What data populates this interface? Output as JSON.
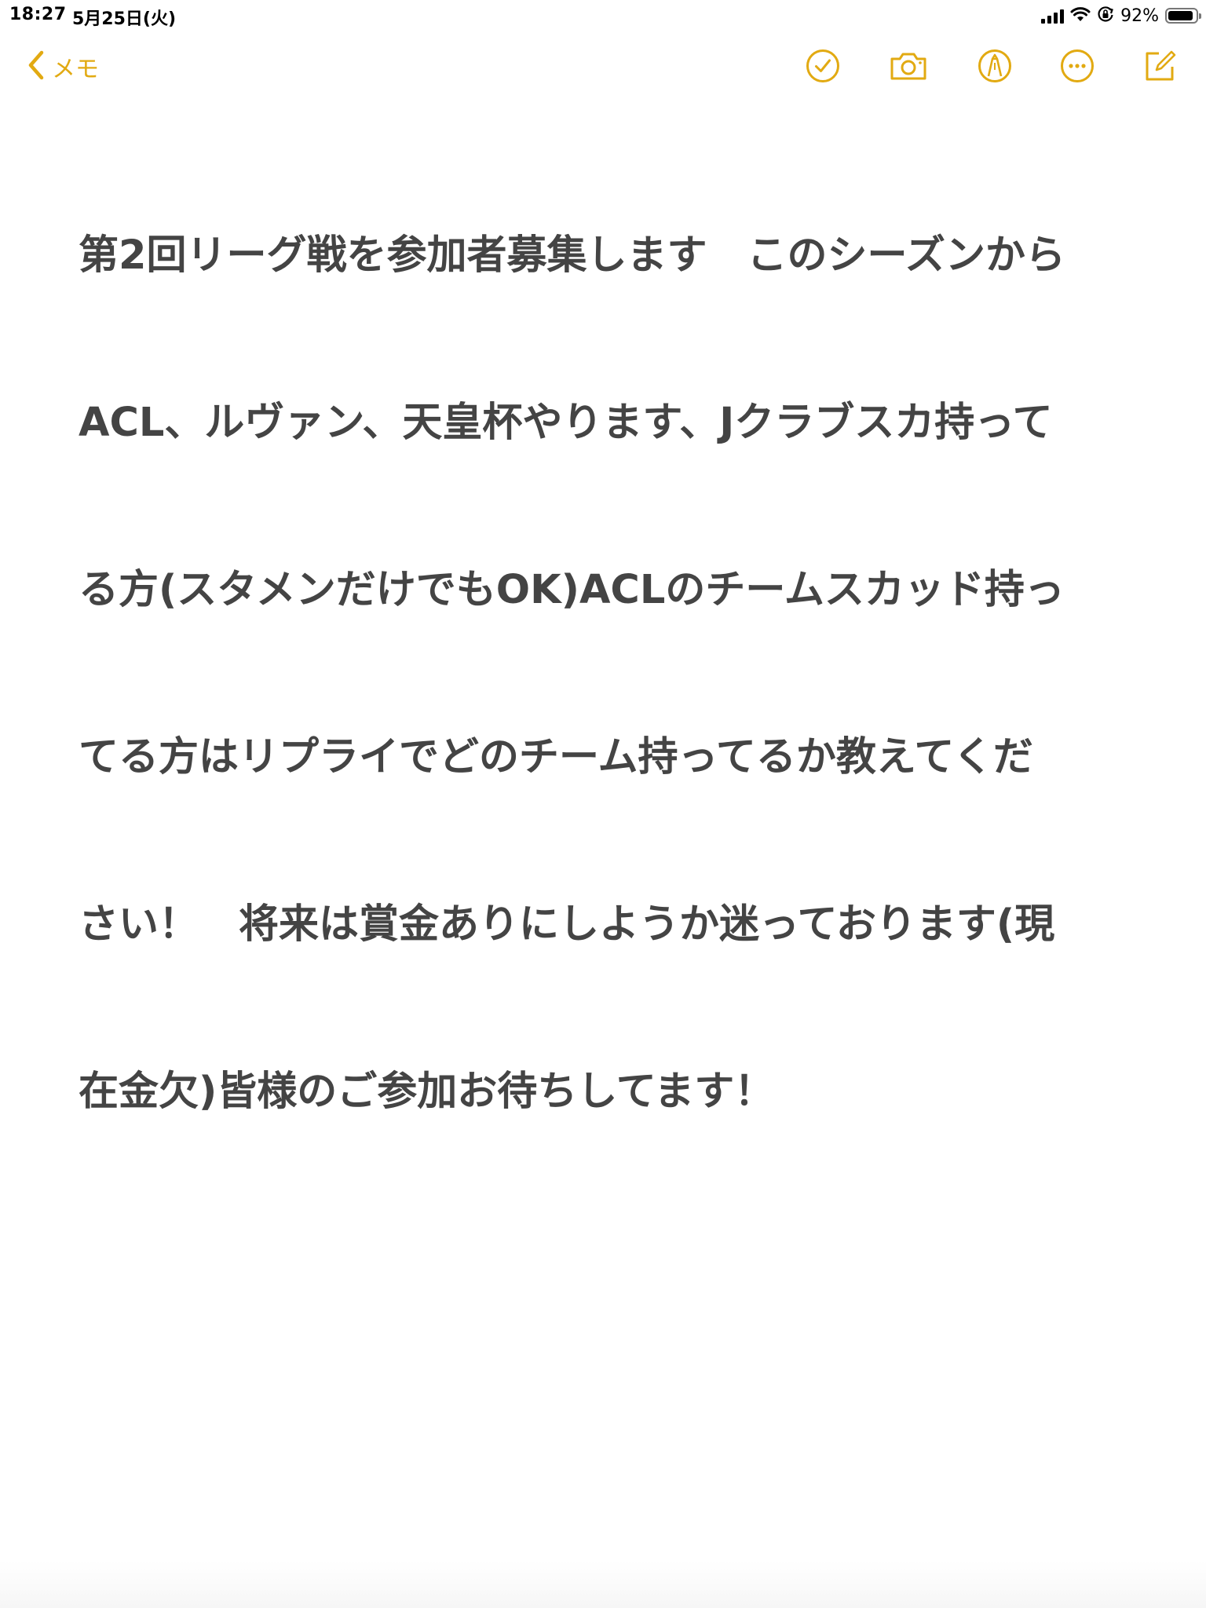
{
  "status_bar": {
    "time": "18:27",
    "date": "5月25日(火)",
    "battery_percent": "92%",
    "battery_level": 0.92,
    "icons": [
      "cellular-signal-icon",
      "wifi-icon",
      "orientation-lock-icon",
      "battery-icon"
    ]
  },
  "nav": {
    "back_label": "メモ",
    "back_icon": "chevron-left-icon",
    "toolbar_icons": [
      "checklist-icon",
      "camera-icon",
      "markup-pen-icon",
      "more-icon",
      "compose-icon"
    ]
  },
  "note": {
    "lines": [
      "第2回リーグ戦を参加者募集します　このシーズンから",
      "ACL、ルヴァン、天皇杯やります、Jクラブスカ持って",
      "る方(スタメンだけでもOK)ACLのチームスカッド持っ",
      "てる方はリプライでどのチーム持ってるか教えてくだ",
      "さい！　将来は賞金ありにしようか迷っております(現",
      "在金欠)皆様のご参加お待ちしてます！"
    ]
  },
  "colors": {
    "accent": "#e2aa12",
    "text": "#444444",
    "background": "#ffffff"
  }
}
